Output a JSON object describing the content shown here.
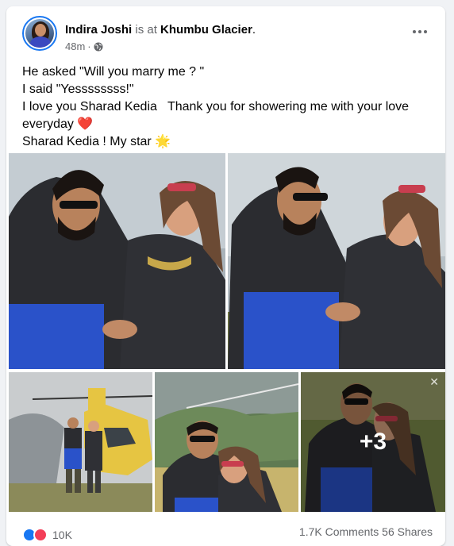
{
  "post": {
    "author": "Indira Joshi",
    "connector": "is at",
    "location": "Khumbu Glacier",
    "location_suffix": ".",
    "time": "48m",
    "separator": "·",
    "lines": [
      "He asked \"Will you marry me ? \"",
      "I said \"Yessssssss!\"",
      "I love you Sharad Kedia   Thank you for showering me with your love everyday",
      "Sharad Kedia ! My star"
    ],
    "heart_emoji": "❤️",
    "star_emoji": "🌟",
    "more_count": "+3",
    "close_glyph": "✕"
  },
  "reactions": {
    "count": "10K",
    "stats": "1.7K Comments  56 Shares"
  },
  "colors": {
    "accent": "#1877f2",
    "secondary_text": "#65676b",
    "love": "#f33e58"
  },
  "icons": [
    "globe-icon",
    "more-options-icon",
    "like-icon",
    "love-icon",
    "close-icon"
  ]
}
